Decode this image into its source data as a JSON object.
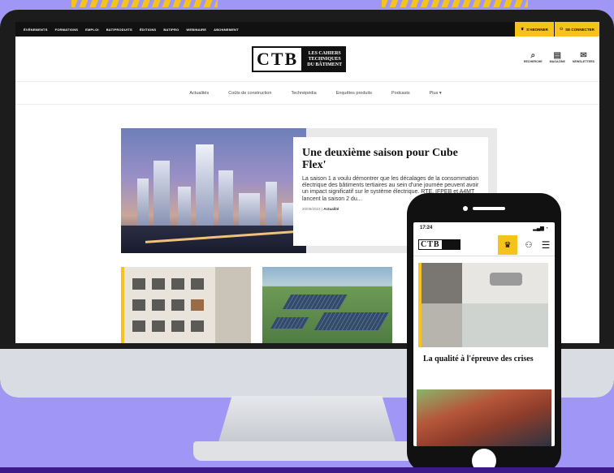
{
  "site": {
    "topnav": [
      "ÉVÉNEMENTS",
      "FORMATIONS",
      "EMPLOI",
      "BATIPRODUITS",
      "ÉDITIONS",
      "BATIPRO",
      "WEBINAIRE",
      "ABONNEMENT"
    ],
    "abonner_label": "S'ABONNER",
    "connect_label": "SE CONNECTER",
    "logo_letters": "CTB",
    "logo_tagline": [
      "LES CAHIERS",
      "TECHNIQUES",
      "DU BÂTIMENT"
    ],
    "header_icons": [
      {
        "icon": "search-icon",
        "label": "RECHERCHE"
      },
      {
        "icon": "magazine-icon",
        "label": "MAGAZINE"
      },
      {
        "icon": "newsletter-icon",
        "label": "NEWSLETTERS"
      }
    ],
    "menu": [
      "Actualités",
      "Coûts de construction",
      "Techné​pédia",
      "Enquêtes produits",
      "Podcasts",
      "Plus ▾"
    ],
    "hero": {
      "title": "Une deuxième saison pour Cube Flex'",
      "excerpt": "La saison 1 a voulu démontrer que les décalages de la consommation électrique des bâtiments tertiaires au sein d'une journée peuvent avoir un impact significatif sur le système électrique. RTE, IFPEB et A4MT lancent la saison 2 du...",
      "date": "20/09/2023",
      "category": "Actualité"
    }
  },
  "phone": {
    "time": "17:24",
    "status_icons": "▂▄▆ ◔",
    "article_title": "La qualité à l'épreuve des crises"
  },
  "colors": {
    "accent": "#f6c21c",
    "background": "#9f96f5",
    "dark": "#111111"
  }
}
